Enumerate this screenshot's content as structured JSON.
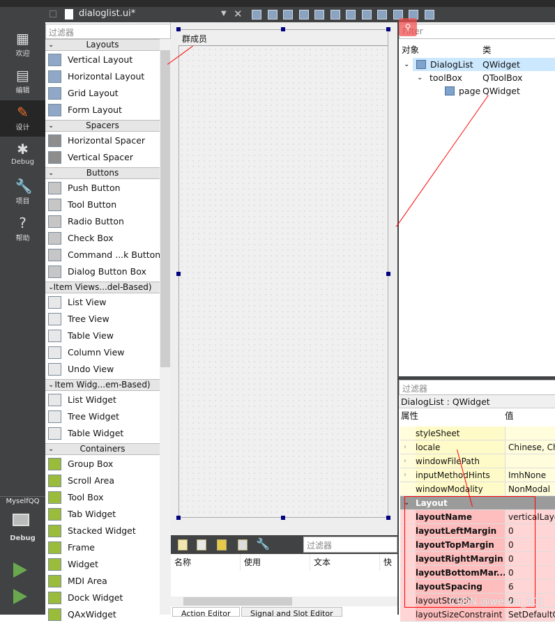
{
  "toolbar": {
    "file_name": "dialoglist.ui*"
  },
  "modes": [
    {
      "label": "欢迎",
      "icon": "grid-icon"
    },
    {
      "label": "编辑",
      "icon": "document-icon"
    },
    {
      "label": "设计",
      "icon": "pencil-icon",
      "active": true
    },
    {
      "label": "Debug",
      "icon": "bug-icon"
    },
    {
      "label": "项目",
      "icon": "wrench-icon"
    },
    {
      "label": "帮助",
      "icon": "help-icon"
    }
  ],
  "kit": {
    "project": "MyselfQQ",
    "config": "Debug"
  },
  "widget_box": {
    "filter_placeholder": "过滤器",
    "categories": [
      {
        "name": "Layouts",
        "items": [
          "Vertical Layout",
          "Horizontal Layout",
          "Grid Layout",
          "Form Layout"
        ]
      },
      {
        "name": "Spacers",
        "items": [
          "Horizontal Spacer",
          "Vertical Spacer"
        ]
      },
      {
        "name": "Buttons",
        "items": [
          "Push Button",
          "Tool Button",
          "Radio Button",
          "Check Box",
          "Command ...k Button",
          "Dialog Button Box"
        ]
      },
      {
        "name": "Item Views...del-Based)",
        "items": [
          "List View",
          "Tree View",
          "Table View",
          "Column View",
          "Undo View"
        ]
      },
      {
        "name": "Item Widg...em-Based)",
        "items": [
          "List Widget",
          "Tree Widget",
          "Table Widget"
        ]
      },
      {
        "name": "Containers",
        "items": [
          "Group Box",
          "Scroll Area",
          "Tool Box",
          "Tab Widget",
          "Stacked Widget",
          "Frame",
          "Widget",
          "MDI Area",
          "Dock Widget",
          "QAxWidget"
        ]
      }
    ]
  },
  "form": {
    "tab_label": "群成员"
  },
  "action_editor": {
    "filter_placeholder": "过滤器",
    "columns": [
      "名称",
      "使用",
      "文本",
      "快捷"
    ],
    "tabs": [
      "Action Editor",
      "Signal and Slot Editor"
    ]
  },
  "object_inspector": {
    "filter_placeholder": "Filter",
    "columns": [
      "对象",
      "类"
    ],
    "rows": [
      {
        "object": "DialogList",
        "class": "QWidget",
        "selected": true
      },
      {
        "object": "toolBox",
        "class": "QToolBox"
      },
      {
        "object": "page",
        "class": "QWidget"
      }
    ]
  },
  "property_editor": {
    "filter_placeholder": "过滤器",
    "object_label": "DialogList : QWidget",
    "columns": [
      "属性",
      "值"
    ],
    "rows": [
      {
        "name": "styleSheet",
        "value": ""
      },
      {
        "name": "locale",
        "value": "Chinese, China"
      },
      {
        "name": "windowFilePath",
        "value": ""
      },
      {
        "name": "inputMethodHints",
        "value": "ImhNone"
      },
      {
        "name": "windowModality",
        "value": "NonModal"
      },
      {
        "name": "Layout",
        "value": "",
        "group": true
      },
      {
        "name": "layoutName",
        "value": "verticalLayout"
      },
      {
        "name": "layoutLeftMargin",
        "value": "0"
      },
      {
        "name": "layoutTopMargin",
        "value": "0"
      },
      {
        "name": "layoutRightMargin",
        "value": "0"
      },
      {
        "name": "layoutBottomMar...",
        "value": "0"
      },
      {
        "name": "layoutSpacing",
        "value": "6"
      },
      {
        "name": "layoutStretch",
        "value": "0"
      },
      {
        "name": "layoutSizeConstraint",
        "value": "SetDefaultConstraint"
      }
    ]
  },
  "watermark": "CSDN @weixin_101",
  "colors": {
    "dark": "#404244",
    "accent": "#f0712c",
    "selected": "#cce8ff",
    "annotation": "#ff0000"
  }
}
